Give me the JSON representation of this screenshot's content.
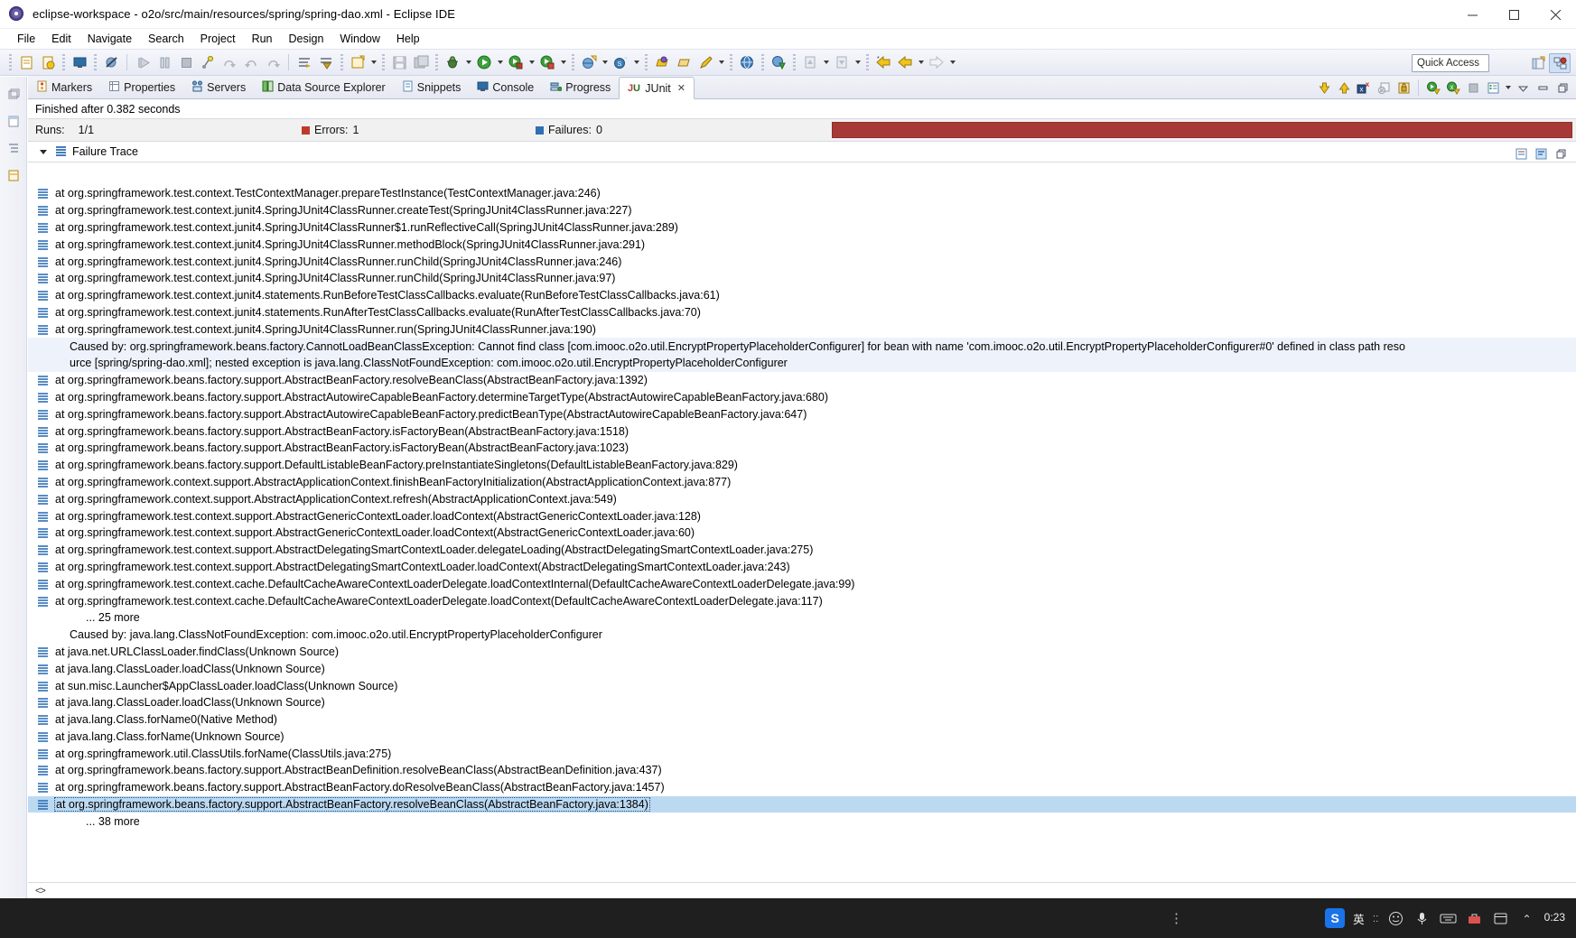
{
  "window": {
    "title": "eclipse-workspace - o2o/src/main/resources/spring/spring-dao.xml - Eclipse IDE",
    "minimize_label": "Minimize",
    "maximize_label": "Maximize",
    "close_label": "Close"
  },
  "menubar": {
    "items": [
      {
        "label": "File",
        "mnemonic": "F"
      },
      {
        "label": "Edit",
        "mnemonic": "E"
      },
      {
        "label": "Navigate",
        "mnemonic": "N"
      },
      {
        "label": "Search",
        "mnemonic": "a"
      },
      {
        "label": "Project",
        "mnemonic": "P"
      },
      {
        "label": "Run",
        "mnemonic": "R"
      },
      {
        "label": "Design",
        "mnemonic": "D"
      },
      {
        "label": "Window",
        "mnemonic": "W"
      },
      {
        "label": "Help",
        "mnemonic": "H"
      }
    ]
  },
  "toolbar": {
    "quick_access_placeholder": "Quick Access",
    "icons": [
      "new-wizard-icon",
      "new-java-project-icon",
      "save-icon",
      "print-icon",
      "resume-icon",
      "suspend-icon",
      "terminate-icon",
      "step-into-icon",
      "step-over-icon",
      "step-return-icon",
      "drop-to-frame-icon",
      "skip-breakpoints-icon",
      "external-tools-icon",
      "new-file-icon",
      "save-all-icon",
      "debug-icon",
      "run-icon",
      "run-config-icon",
      "coverage-icon",
      "open-web-browser-icon",
      "search-icon",
      "open-type-icon",
      "open-task-icon",
      "pencil-icon",
      "globe-icon",
      "link-icon",
      "next-annotation-icon",
      "previous-annotation-icon",
      "back-icon",
      "forward-icon"
    ],
    "perspective_buttons": [
      "open-perspective-icon",
      "java-ee-perspective-icon"
    ]
  },
  "left_strip": {
    "buttons": [
      "restore-icon",
      "package-explorer-icon",
      "outline-icon",
      "servers-icon"
    ]
  },
  "view_tabs": {
    "items": [
      {
        "label": "Markers",
        "icon": "markers-icon",
        "active": false
      },
      {
        "label": "Properties",
        "icon": "properties-icon",
        "active": false
      },
      {
        "label": "Servers",
        "icon": "servers-icon",
        "active": false
      },
      {
        "label": "Data Source Explorer",
        "icon": "data-source-explorer-icon",
        "active": false
      },
      {
        "label": "Snippets",
        "icon": "snippets-icon",
        "active": false
      },
      {
        "label": "Console",
        "icon": "console-icon",
        "active": false
      },
      {
        "label": "Progress",
        "icon": "progress-icon",
        "active": false
      },
      {
        "label": "JUnit",
        "icon": "junit-icon",
        "active": true,
        "close": "✕"
      }
    ],
    "tools": [
      "next-failure-icon",
      "previous-failure-icon",
      "show-failures-only-icon",
      "stop-icon",
      "lock-scroll-icon",
      "rerun-test-icon",
      "rerun-failed-icon",
      "terminate-icon",
      "test-history-icon",
      "view-menu-icon",
      "minimize-view-icon",
      "maximize-view-icon",
      "restore-view-icon"
    ]
  },
  "junit": {
    "finished_text": "Finished after 0.382 seconds",
    "stats": {
      "runs_label": "Runs:",
      "runs_value": "1/1",
      "errors_label": "Errors:",
      "errors_value": "1",
      "failures_label": "Failures:",
      "failures_value": "0"
    },
    "progress_color": "#a63a36",
    "failure_trace_label": "Failure Trace",
    "trace": [
      {
        "type": "frame",
        "text": "at org.springframework.test.context.TestContextManager.prepareTestInstance(TestContextManager.java:246)"
      },
      {
        "type": "frame",
        "text": "at org.springframework.test.context.junit4.SpringJUnit4ClassRunner.createTest(SpringJUnit4ClassRunner.java:227)"
      },
      {
        "type": "frame",
        "text": "at org.springframework.test.context.junit4.SpringJUnit4ClassRunner$1.runReflectiveCall(SpringJUnit4ClassRunner.java:289)"
      },
      {
        "type": "frame",
        "text": "at org.springframework.test.context.junit4.SpringJUnit4ClassRunner.methodBlock(SpringJUnit4ClassRunner.java:291)"
      },
      {
        "type": "frame",
        "text": "at org.springframework.test.context.junit4.SpringJUnit4ClassRunner.runChild(SpringJUnit4ClassRunner.java:246)"
      },
      {
        "type": "frame",
        "text": "at org.springframework.test.context.junit4.SpringJUnit4ClassRunner.runChild(SpringJUnit4ClassRunner.java:97)"
      },
      {
        "type": "frame",
        "text": "at org.springframework.test.context.junit4.statements.RunBeforeTestClassCallbacks.evaluate(RunBeforeTestClassCallbacks.java:61)"
      },
      {
        "type": "frame",
        "text": "at org.springframework.test.context.junit4.statements.RunAfterTestClassCallbacks.evaluate(RunAfterTestClassCallbacks.java:70)"
      },
      {
        "type": "frame",
        "text": "at org.springframework.test.context.junit4.SpringJUnit4ClassRunner.run(SpringJUnit4ClassRunner.java:190)"
      },
      {
        "type": "caused",
        "highlight": true,
        "text": "Caused by: org.springframework.beans.factory.CannotLoadBeanClassException: Cannot find class [com.imooc.o2o.util.EncryptPropertyPlaceholderConfigurer] for bean with name 'com.imooc.o2o.util.EncryptPropertyPlaceholderConfigurer#0' defined in class path reso"
      },
      {
        "type": "caused",
        "highlight": true,
        "text": "urce [spring/spring-dao.xml]; nested exception is java.lang.ClassNotFoundException: com.imooc.o2o.util.EncryptPropertyPlaceholderConfigurer"
      },
      {
        "type": "frame",
        "text": "at org.springframework.beans.factory.support.AbstractBeanFactory.resolveBeanClass(AbstractBeanFactory.java:1392)"
      },
      {
        "type": "frame",
        "text": "at org.springframework.beans.factory.support.AbstractAutowireCapableBeanFactory.determineTargetType(AbstractAutowireCapableBeanFactory.java:680)"
      },
      {
        "type": "frame",
        "text": "at org.springframework.beans.factory.support.AbstractAutowireCapableBeanFactory.predictBeanType(AbstractAutowireCapableBeanFactory.java:647)"
      },
      {
        "type": "frame",
        "text": "at org.springframework.beans.factory.support.AbstractBeanFactory.isFactoryBean(AbstractBeanFactory.java:1518)"
      },
      {
        "type": "frame",
        "text": "at org.springframework.beans.factory.support.AbstractBeanFactory.isFactoryBean(AbstractBeanFactory.java:1023)"
      },
      {
        "type": "frame",
        "text": "at org.springframework.beans.factory.support.DefaultListableBeanFactory.preInstantiateSingletons(DefaultListableBeanFactory.java:829)"
      },
      {
        "type": "frame",
        "text": "at org.springframework.context.support.AbstractApplicationContext.finishBeanFactoryInitialization(AbstractApplicationContext.java:877)"
      },
      {
        "type": "frame",
        "text": "at org.springframework.context.support.AbstractApplicationContext.refresh(AbstractApplicationContext.java:549)"
      },
      {
        "type": "frame",
        "text": "at org.springframework.test.context.support.AbstractGenericContextLoader.loadContext(AbstractGenericContextLoader.java:128)"
      },
      {
        "type": "frame",
        "text": "at org.springframework.test.context.support.AbstractGenericContextLoader.loadContext(AbstractGenericContextLoader.java:60)"
      },
      {
        "type": "frame",
        "text": "at org.springframework.test.context.support.AbstractDelegatingSmartContextLoader.delegateLoading(AbstractDelegatingSmartContextLoader.java:275)"
      },
      {
        "type": "frame",
        "text": "at org.springframework.test.context.support.AbstractDelegatingSmartContextLoader.loadContext(AbstractDelegatingSmartContextLoader.java:243)"
      },
      {
        "type": "frame",
        "text": "at org.springframework.test.context.cache.DefaultCacheAwareContextLoaderDelegate.loadContextInternal(DefaultCacheAwareContextLoaderDelegate.java:99)"
      },
      {
        "type": "frame",
        "text": "at org.springframework.test.context.cache.DefaultCacheAwareContextLoaderDelegate.loadContext(DefaultCacheAwareContextLoaderDelegate.java:117)"
      },
      {
        "type": "more",
        "text": "... 25 more"
      },
      {
        "type": "caused",
        "highlight": false,
        "text": "Caused by: java.lang.ClassNotFoundException: com.imooc.o2o.util.EncryptPropertyPlaceholderConfigurer"
      },
      {
        "type": "frame",
        "text": "at java.net.URLClassLoader.findClass(Unknown Source)"
      },
      {
        "type": "frame",
        "text": "at java.lang.ClassLoader.loadClass(Unknown Source)"
      },
      {
        "type": "frame",
        "text": "at sun.misc.Launcher$AppClassLoader.loadClass(Unknown Source)"
      },
      {
        "type": "frame",
        "text": "at java.lang.ClassLoader.loadClass(Unknown Source)"
      },
      {
        "type": "frame",
        "text": "at java.lang.Class.forName0(Native Method)"
      },
      {
        "type": "frame",
        "text": "at java.lang.Class.forName(Unknown Source)"
      },
      {
        "type": "frame",
        "text": "at org.springframework.util.ClassUtils.forName(ClassUtils.java:275)"
      },
      {
        "type": "frame",
        "text": "at org.springframework.beans.factory.support.AbstractBeanDefinition.resolveBeanClass(AbstractBeanDefinition.java:437)"
      },
      {
        "type": "frame",
        "text": "at org.springframework.beans.factory.support.AbstractBeanFactory.doResolveBeanClass(AbstractBeanFactory.java:1457)"
      },
      {
        "type": "frame",
        "selected": true,
        "text": "at org.springframework.beans.factory.support.AbstractBeanFactory.resolveBeanClass(AbstractBeanFactory.java:1384)"
      },
      {
        "type": "more",
        "text": "... 38 more"
      }
    ],
    "status_line": "<>"
  },
  "taskbar": {
    "ime_badge": "S",
    "ime_lang": "英",
    "ime_symbol": "ːː",
    "icons": [
      "emoji-icon",
      "microphone-icon",
      "keyboard-icon",
      "toolbox-icon",
      "settings-icon",
      "more-icon"
    ],
    "clock_time": "0:23",
    "watermark": ""
  }
}
